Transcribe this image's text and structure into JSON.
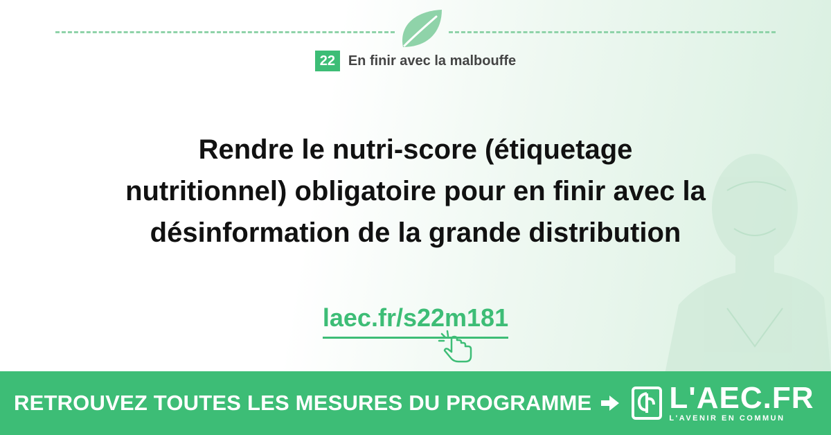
{
  "colors": {
    "accent": "#3dbd76",
    "accent_light": "#8fd3a9",
    "text": "#111111"
  },
  "header": {
    "icon": "leaf-icon",
    "chapter_number": "22",
    "chapter_title": "En finir avec la malbouffe"
  },
  "main": {
    "headline_lines": [
      "Rendre le nutri-score (étiquetage",
      "nutritionnel) obligatoire pour en finir avec la",
      "désinformation de la grande distribution"
    ],
    "link_text": "laec.fr/s22m181",
    "link_icon": "pointer-hand-icon"
  },
  "footer": {
    "cta": "RETROUVEZ TOUTES LES MESURES DU PROGRAMME",
    "arrow_icon": "arrow-right-icon",
    "logo_icon": "laec-book-icon",
    "brand_name": "L'AEC.FR",
    "brand_tagline": "L'AVENIR EN COMMUN"
  }
}
